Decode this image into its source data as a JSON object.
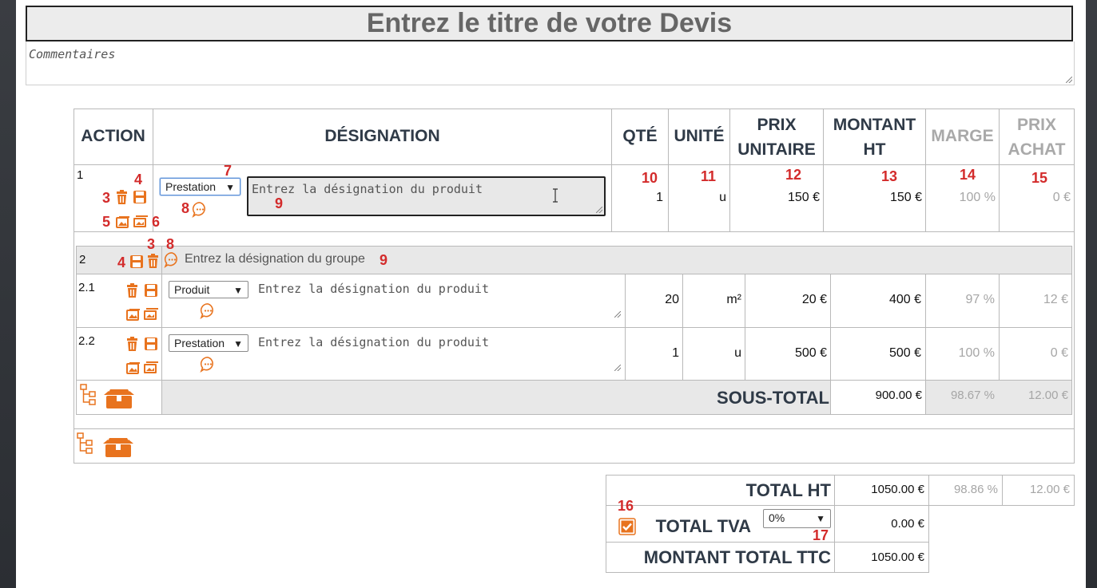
{
  "title": "Entrez le titre de votre Devis",
  "comments_placeholder": "Commentaires",
  "headers": {
    "action": "ACTION",
    "designation": "DÉSIGNATION",
    "qty": "QTÉ",
    "unit": "UNITÉ",
    "unit_price_1": "PRIX",
    "unit_price_2": "UNITAIRE",
    "amount_1": "MONTANT",
    "amount_2": "HT",
    "margin": "MARGE",
    "purchase_1": "PRIX",
    "purchase_2": "ACHAT"
  },
  "markers": {
    "m4": "4",
    "m3": "3",
    "m5": "5",
    "m6": "6",
    "m7": "7",
    "m8": "8",
    "m9": "9",
    "m10": "10",
    "m11": "11",
    "m12": "12",
    "m13": "13",
    "m14": "14",
    "m15": "15",
    "g3": "3",
    "g8": "8",
    "g4": "4",
    "g9": "9",
    "m16": "16",
    "m17": "17"
  },
  "row1": {
    "index": "1",
    "type": "Prestation",
    "placeholder": "Entrez la désignation du produit",
    "qty": "1",
    "unit": "u",
    "unit_price": "150 €",
    "amount": "150 €",
    "margin": "100 %",
    "purchase": "0 €"
  },
  "group": {
    "index": "2",
    "placeholder": "Entrez la désignation du groupe",
    "items": [
      {
        "index": "2.1",
        "type": "Produit",
        "placeholder": "Entrez la désignation du produit",
        "qty": "20",
        "unit": "m²",
        "unit_price": "20 €",
        "amount": "400 €",
        "margin": "97 %",
        "purchase": "12 €"
      },
      {
        "index": "2.2",
        "type": "Prestation",
        "placeholder": "Entrez la désignation du produit",
        "qty": "1",
        "unit": "u",
        "unit_price": "500 €",
        "amount": "500 €",
        "margin": "100 %",
        "purchase": "0 €"
      }
    ],
    "subtotal_label": "SOUS-TOTAL",
    "subtotal_amount": "900.00 €",
    "subtotal_margin": "98.67 %",
    "subtotal_purchase": "12.00 €"
  },
  "totals": {
    "ht_label": "TOTAL HT",
    "ht_amount": "1050.00 €",
    "ht_margin": "98.86 %",
    "ht_purchase": "12.00 €",
    "tva_label": "TOTAL TVA",
    "tva_rate": "0%",
    "tva_amount": "0.00 €",
    "tva_checked": true,
    "ttc_label": "MONTANT TOTAL TTC",
    "ttc_amount": "1050.00 €"
  },
  "colors": {
    "accent": "#e8731e",
    "marker": "#d32b2b",
    "header_text": "#2f3a47"
  },
  "icons": [
    "trash-icon",
    "save-icon",
    "image-icon",
    "gallery-icon",
    "comment-icon",
    "tree-icon",
    "box-icon",
    "checkbox-icon"
  ]
}
